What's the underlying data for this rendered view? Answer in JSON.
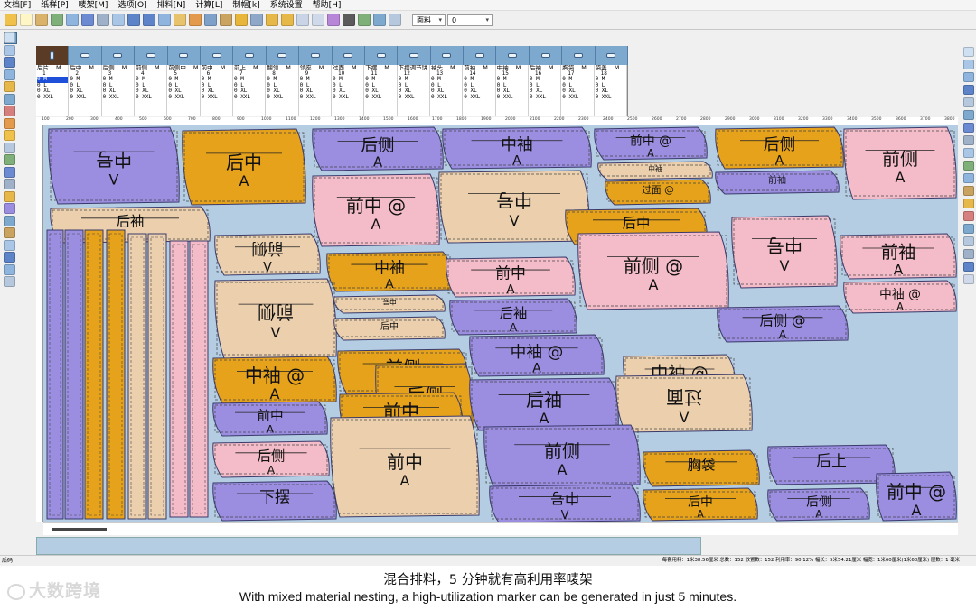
{
  "menus": [
    "文档[F]",
    "纸样[P]",
    "唛架[M]",
    "选项[O]",
    "排料[N]",
    "计算[L]",
    "制帽[k]",
    "系统设置",
    "帮助[H]"
  ],
  "toolbar": {
    "material_label": "面料",
    "material_value": "0"
  },
  "pieces": [
    {
      "name": "后片",
      "size_row": "1",
      "qty": "M",
      "num": "1",
      "rows": [
        "0 M",
        "0 L",
        "0 XL",
        "0 XXL"
      ]
    },
    {
      "name": "后中",
      "size_row": "M",
      "qty": "M",
      "num": "2",
      "rows": [
        "0 M",
        "0 L",
        "0 XL",
        "0 XXL"
      ]
    },
    {
      "name": "后侧",
      "size_row": "M",
      "qty": "M",
      "num": "3",
      "rows": [
        "0 M",
        "0 L",
        "0 XL",
        "0 XXL"
      ]
    },
    {
      "name": "前侧",
      "size_row": "M",
      "qty": "M",
      "num": "4",
      "rows": [
        "0 M",
        "0 L",
        "0 XL",
        "0 XXL"
      ]
    },
    {
      "name": "前侧中",
      "size_row": "M",
      "qty": "M",
      "num": "5",
      "rows": [
        "0 M",
        "0 L",
        "0 XL",
        "0 XXL"
      ]
    },
    {
      "name": "前中",
      "size_row": "M",
      "qty": "M",
      "num": "6",
      "rows": [
        "0 M",
        "0 L",
        "0 XL",
        "0 XXL"
      ]
    },
    {
      "name": "前上",
      "size_row": "M",
      "qty": "M",
      "num": "7",
      "rows": [
        "0 M",
        "0 L",
        "0 XL",
        "0 XXL"
      ]
    },
    {
      "name": "翻领",
      "size_row": "M",
      "qty": "M",
      "num": "8",
      "rows": [
        "0 M",
        "0 L",
        "0 XL",
        "0 XXL"
      ]
    },
    {
      "name": "领座",
      "size_row": "M",
      "qty": "M",
      "num": "9",
      "rows": [
        "0 M",
        "0 L",
        "0 XL",
        "0 XXL"
      ]
    },
    {
      "name": "过面",
      "size_row": "M",
      "qty": "M",
      "num": "10",
      "rows": [
        "0 M",
        "0 L",
        "0 XL",
        "0 XXL"
      ]
    },
    {
      "name": "下摆",
      "size_row": "M",
      "qty": "M",
      "num": "11",
      "rows": [
        "0 M",
        "0 L",
        "0 XL",
        "0 XXL"
      ]
    },
    {
      "name": "下摆调节饼",
      "size_row": "M",
      "qty": "M",
      "num": "12",
      "rows": [
        "0 M",
        "0 L",
        "0 XL",
        "0 XXL"
      ]
    },
    {
      "name": "袖头",
      "size_row": "M",
      "qty": "M",
      "num": "13",
      "rows": [
        "0 M",
        "0 L",
        "0 XL",
        "0 XXL"
      ]
    },
    {
      "name": "前袖",
      "size_row": "M",
      "qty": "M",
      "num": "14",
      "rows": [
        "0 M",
        "0 L",
        "0 XL",
        "0 XXL"
      ]
    },
    {
      "name": "中袖",
      "size_row": "M",
      "qty": "M",
      "num": "15",
      "rows": [
        "0 M",
        "0 L",
        "0 XL",
        "0 XXL"
      ]
    },
    {
      "name": "后袖",
      "size_row": "M",
      "qty": "M",
      "num": "16",
      "rows": [
        "0 M",
        "0 L",
        "0 XL",
        "0 XXL"
      ]
    },
    {
      "name": "胸袋",
      "size_row": "M",
      "qty": "M",
      "num": "17",
      "rows": [
        "0 M",
        "0 L",
        "0 XL",
        "0 XXL"
      ]
    },
    {
      "name": "袋盖",
      "size_row": "M",
      "qty": "M",
      "num": "18",
      "rows": [
        "0 M",
        "0 L",
        "0 XL",
        "0 XXL"
      ]
    }
  ],
  "ruler_ticks": [
    "100",
    "200",
    "300",
    "400",
    "500",
    "600",
    "700",
    "800",
    "900",
    "1000",
    "1100",
    "1200",
    "1300",
    "1400",
    "1500",
    "1600",
    "1700",
    "1800",
    "1900",
    "2000",
    "2100",
    "2200",
    "2300",
    "2400",
    "2500",
    "2600",
    "2700",
    "2800",
    "2900",
    "3000",
    "3100",
    "3200",
    "3300",
    "3400",
    "3500",
    "3600",
    "3700",
    "3800"
  ],
  "colors": {
    "purple": "#9b8ee0",
    "orange": "#e6a21a",
    "pink": "#f4bcc8",
    "tan": "#ecd0ae",
    "fabric": "#b4cde3"
  },
  "marker_pieces": [
    {
      "label": "中号",
      "sub": "V",
      "color": "purple",
      "flip": true
    },
    {
      "label": "后中",
      "sub": "A",
      "color": "orange"
    },
    {
      "label": "后侧",
      "sub": "A",
      "color": "purple"
    },
    {
      "label": "前中 @",
      "sub": "A",
      "color": "purple"
    },
    {
      "label": "后侧",
      "sub": "A",
      "color": "orange"
    },
    {
      "label": "中袖",
      "sub": "A",
      "color": "purple"
    },
    {
      "label": "中号",
      "sub": "V",
      "color": "tan",
      "flip": true
    },
    {
      "label": "前中 @",
      "sub": "A",
      "color": "pink"
    },
    {
      "label": "中袖",
      "sub": "A",
      "color": "tan"
    },
    {
      "label": "过面 @",
      "sub": "",
      "color": "orange"
    },
    {
      "label": "前侧",
      "sub": "A",
      "color": "pink"
    },
    {
      "label": "前袖",
      "sub": "A",
      "color": "purple"
    },
    {
      "label": "后袖",
      "sub": "",
      "color": "tan"
    },
    {
      "label": "前侧",
      "sub": "V",
      "color": "tan",
      "flip": true
    },
    {
      "label": "后中",
      "sub": "A",
      "color": "orange"
    },
    {
      "label": "中号",
      "sub": "V",
      "color": "pink",
      "flip": true
    },
    {
      "label": "中袖",
      "sub": "A",
      "color": "orange"
    },
    {
      "label": "前侧",
      "sub": "V",
      "color": "tan",
      "flip": true
    },
    {
      "label": "前中",
      "sub": "A",
      "color": "pink"
    },
    {
      "label": "前侧 @",
      "sub": "A",
      "color": "pink"
    },
    {
      "label": "前袖",
      "sub": "A",
      "color": "pink"
    },
    {
      "label": "中号",
      "sub": "V",
      "color": "tan",
      "flip": true
    },
    {
      "label": "后袖",
      "sub": "A",
      "color": "purple"
    },
    {
      "label": "后侧 @",
      "sub": "A",
      "color": "purple"
    },
    {
      "label": "后中",
      "sub": "A",
      "color": "tan"
    },
    {
      "label": "中袖 @",
      "sub": "A",
      "color": "pink"
    },
    {
      "label": "中袖 @",
      "sub": "A",
      "color": "orange"
    },
    {
      "label": "前侧",
      "sub": "A",
      "color": "orange"
    },
    {
      "label": "中袖 @",
      "sub": "A",
      "color": "purple"
    },
    {
      "label": "中袖 @",
      "sub": "A",
      "color": "tan"
    },
    {
      "label": "后侧",
      "sub": "A",
      "color": "orange"
    },
    {
      "label": "后袖",
      "sub": "A",
      "color": "purple"
    },
    {
      "label": "过面",
      "sub": "V",
      "color": "tan",
      "flip": true
    },
    {
      "label": "前中",
      "sub": "A",
      "color": "purple"
    },
    {
      "label": "前中",
      "sub": "A",
      "color": "orange"
    },
    {
      "label": "后侧",
      "sub": "A",
      "color": "pink"
    },
    {
      "label": "前中",
      "sub": "A",
      "color": "tan"
    },
    {
      "label": "前侧",
      "sub": "A",
      "color": "purple"
    },
    {
      "label": "胸袋",
      "sub": "",
      "color": "orange"
    },
    {
      "label": "后上",
      "sub": "",
      "color": "purple"
    },
    {
      "label": "下摆",
      "sub": "",
      "color": "purple"
    }
  ],
  "statusbar": {
    "left": "后码",
    "right": "每套用料：1米38.56厘米  总数：152  放置数：152  利用率：90.12%  幅长：5米54.21厘米  幅宽：1米60厘米(1米60厘米)  层数：1  毫米"
  },
  "caption": {
    "zh": "混合排料，5 分钟就有高利用率唛架",
    "en": "With mixed material nesting, a high-utilization marker can be generated in just 5 minutes.",
    "brand": "大数跨境"
  }
}
